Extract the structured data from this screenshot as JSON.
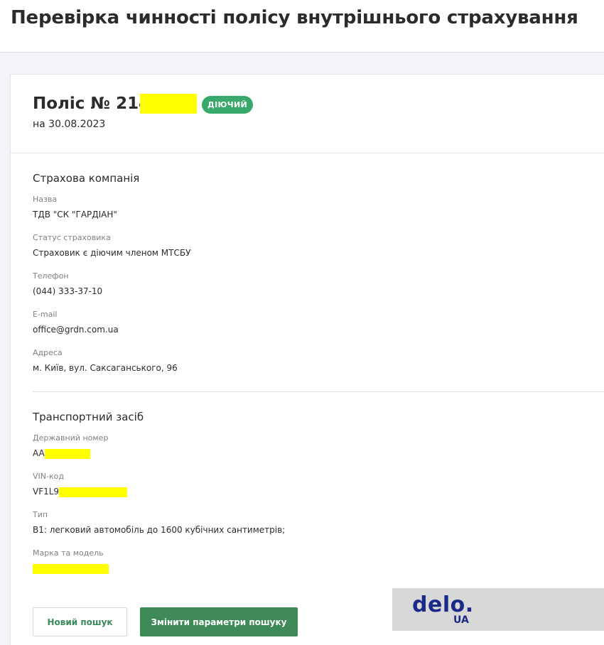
{
  "page": {
    "title": "Перевірка чинності полісу внутрішнього страхування"
  },
  "policy": {
    "title_prefix": "Поліс № 214",
    "status": "ДІЮЧИЙ",
    "date": "на 30.08.2023"
  },
  "insurer": {
    "section_title": "Страхова компанія",
    "fields": [
      {
        "label": "Назва",
        "value": "ТДВ \"СК \"ГАРДІАН\""
      },
      {
        "label": "Статус страховика",
        "value": "Страховик є діючим членом МТСБУ"
      },
      {
        "label": "Телефон",
        "value": "(044) 333-37-10"
      },
      {
        "label": "E-mail",
        "value": "office@grdn.com.ua"
      },
      {
        "label": "Адреса",
        "value": "м. Київ, вул. Саксаганського, 96"
      }
    ]
  },
  "vehicle": {
    "section_title": "Транспортний засіб",
    "fields": [
      {
        "label": "Державний номер",
        "value": "AA"
      },
      {
        "label": "VIN-код",
        "value": "VF1L9"
      },
      {
        "label": "Тип",
        "value": "B1: легковий автомобіль до 1600 кубічних сантиметрів;"
      },
      {
        "label": "Марка та модель",
        "value": ""
      }
    ]
  },
  "actions": {
    "new_search": "Новий пошук",
    "change_params": "Змінити параметри пошуку"
  },
  "watermark": {
    "main": "delo.",
    "sub": "UA"
  },
  "colors": {
    "accent_green": "#3d8a57",
    "status_green": "#39a86b",
    "redaction": "#ffff00",
    "watermark_text": "#1b2a88"
  }
}
